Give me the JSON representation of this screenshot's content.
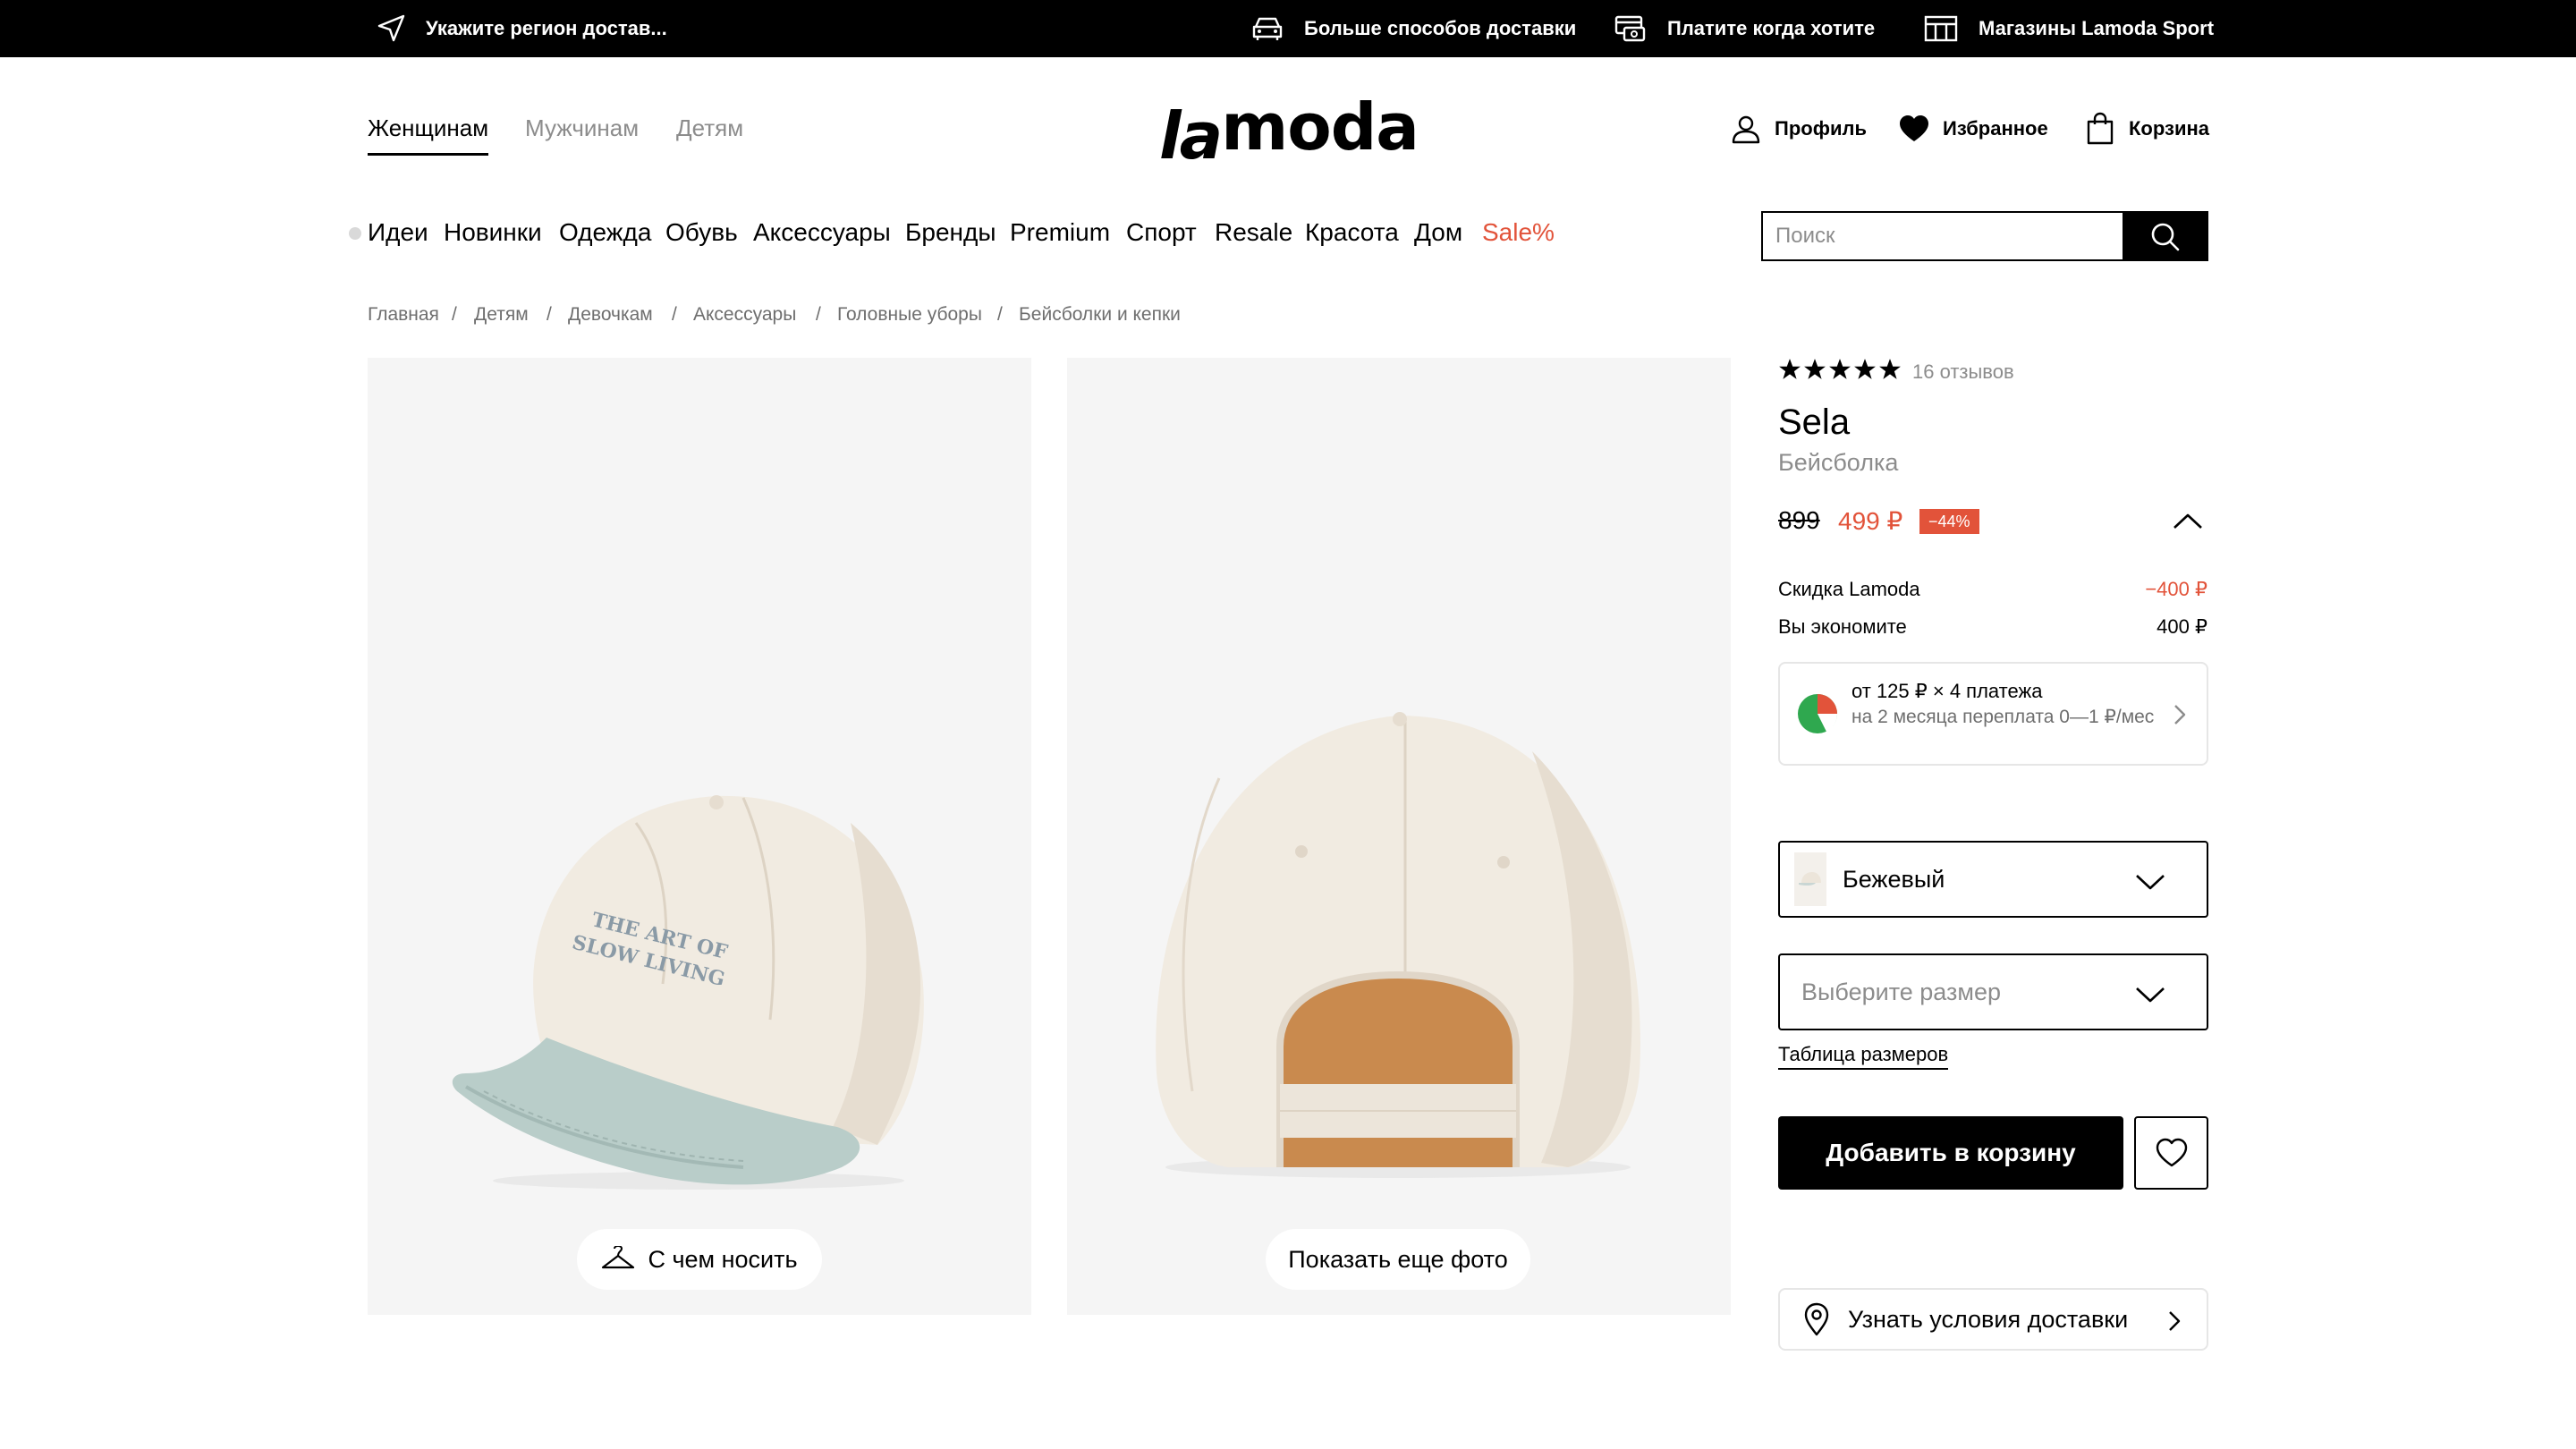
{
  "topbar": {
    "region": "Укажите регион достав...",
    "delivery_ways": "Больше способов доставки",
    "pay_when": "Платите когда хотите",
    "stores": "Магазины Lamoda Sport"
  },
  "header": {
    "gender_tabs": [
      "Женщинам",
      "Мужчинам",
      "Детям"
    ],
    "active_gender": "Женщинам",
    "logo_la": "la",
    "logo_moda": "moda",
    "profile": "Профиль",
    "favorites": "Избранное",
    "cart": "Корзина"
  },
  "categories": [
    "Идеи",
    "Новинки",
    "Одежда",
    "Обувь",
    "Аксессуары",
    "Бренды",
    "Premium",
    "Спорт",
    "Resale",
    "Красота",
    "Дом",
    "Sale%"
  ],
  "search": {
    "placeholder": "Поиск"
  },
  "breadcrumbs": [
    "Главная",
    "Детям",
    "Девочкам",
    "Аксессуары",
    "Головные уборы",
    "Бейсболки и кепки"
  ],
  "breadcrumb_sep": "/",
  "gallery": {
    "cap_text_line1": "THE ART OF",
    "cap_text_line2": "SLOW LIVING",
    "what_to_wear": "С чем носить",
    "more_photos": "Показать еще фото"
  },
  "product": {
    "rating_stars": 5,
    "reviews": "16 отзывов",
    "brand": "Sela",
    "type": "Бейсболка",
    "old_price": "899",
    "new_price": "499 ₽",
    "discount_badge": "−44%",
    "lamoda_discount_label": "Скидка Lamoda",
    "lamoda_discount_value": "−400 ₽",
    "savings_label": "Вы экономите",
    "savings_value": "400 ₽",
    "bnpl_line1": "от 125 ₽ × 4 платежа",
    "bnpl_line2": "на 2 месяца переплата 0—1 ₽/мес",
    "color": "Бежевый",
    "size_placeholder": "Выберите размер",
    "size_table": "Таблица размеров",
    "add_to_cart": "Добавить в корзину",
    "delivery_terms": "Узнать условия доставки"
  },
  "colors": {
    "sale": "#e2533a",
    "black": "#000000",
    "muted": "#8c8c8c",
    "photo_bg": "#f5f5f5"
  }
}
